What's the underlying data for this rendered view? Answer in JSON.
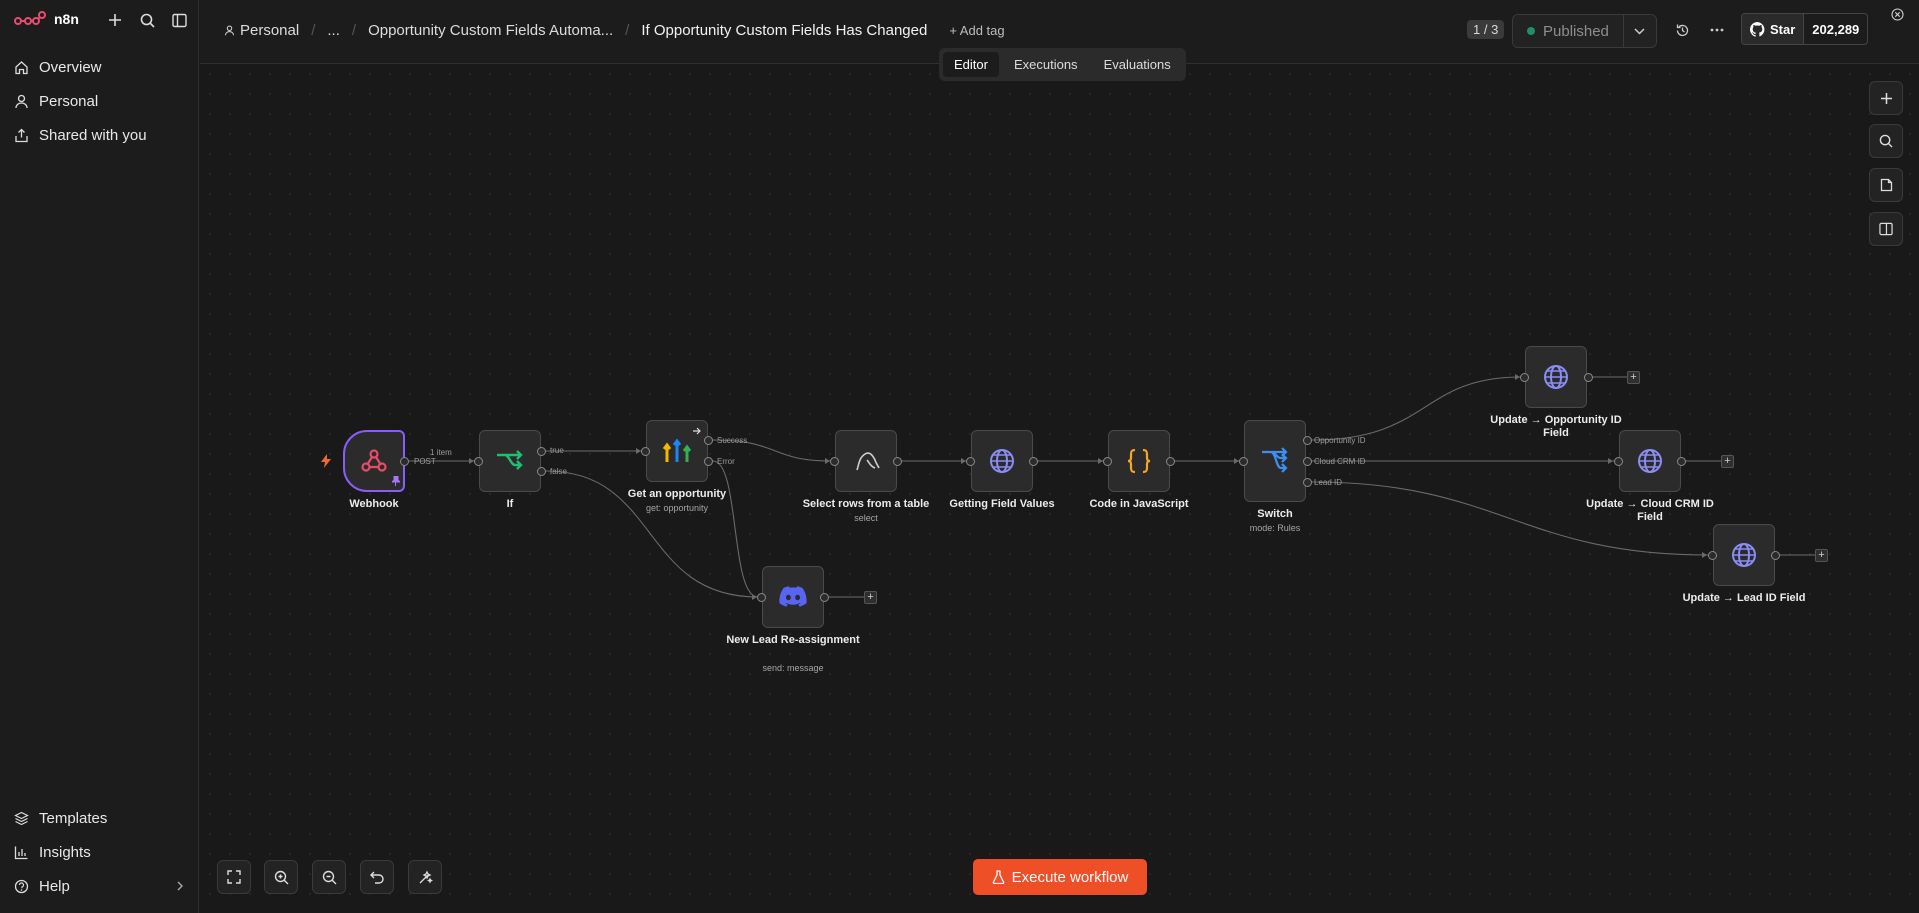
{
  "app": {
    "name": "n8n"
  },
  "sidebar": {
    "items": [
      {
        "label": "Overview",
        "icon": "home-icon"
      },
      {
        "label": "Personal",
        "icon": "user-icon"
      },
      {
        "label": "Shared with you",
        "icon": "share-icon"
      }
    ],
    "bottom_items": [
      {
        "label": "Templates",
        "icon": "templates-icon"
      },
      {
        "label": "Insights",
        "icon": "chart-icon"
      },
      {
        "label": "Help",
        "icon": "help-icon"
      }
    ]
  },
  "header": {
    "breadcrumbs": [
      "Personal",
      "...",
      "Opportunity Custom Fields Automa..."
    ],
    "workflow_title": "If Opportunity Custom Fields Has Changed",
    "add_tag": "+ Add tag",
    "tabs": [
      "Editor",
      "Executions",
      "Evaluations"
    ],
    "active_tab": "Editor",
    "pager": "1 / 3",
    "status": "Published",
    "github_star": "Star",
    "github_count": "202,289"
  },
  "nodes": {
    "webhook": {
      "label": "Webhook",
      "icon": "webhook-icon"
    },
    "if": {
      "label": "If",
      "icon": "if-branch-icon"
    },
    "get_opportunity": {
      "label": "Get an opportunity",
      "sub": "get: opportunity",
      "icon": "highlevel-icon"
    },
    "select_rows": {
      "label": "Select rows from a table",
      "sub": "select",
      "icon": "mysql-icon"
    },
    "getting_field_values": {
      "label": "Getting Field Values",
      "icon": "globe-icon"
    },
    "code_js": {
      "label": "Code in JavaScript",
      "icon": "code-braces-icon"
    },
    "switch": {
      "label": "Switch",
      "sub": "mode: Rules",
      "icon": "switch-icon"
    },
    "update_opp": {
      "label": "Update → Opportunity ID Field",
      "icon": "globe-icon"
    },
    "update_crm": {
      "label": "Update → Cloud CRM ID Field",
      "icon": "globe-icon"
    },
    "update_lead": {
      "label": "Update → Lead ID Field",
      "icon": "globe-icon"
    },
    "new_lead": {
      "label": "New Lead Re-assignment",
      "sub": "send: message",
      "icon": "discord-icon"
    }
  },
  "wire_labels": {
    "post": "POST",
    "items": "1 item",
    "if_true": "true",
    "if_false": "false",
    "success": "Success",
    "error": "Error",
    "opp_id": "Opportunity ID",
    "crm_id": "Cloud CRM ID",
    "lead_id": "Lead ID"
  },
  "actions": {
    "execute": "Execute workflow"
  },
  "colors": {
    "accent": "#ee4f27",
    "trigger_border": "#8b5cf6",
    "published_dot": "#1f8f6a"
  }
}
